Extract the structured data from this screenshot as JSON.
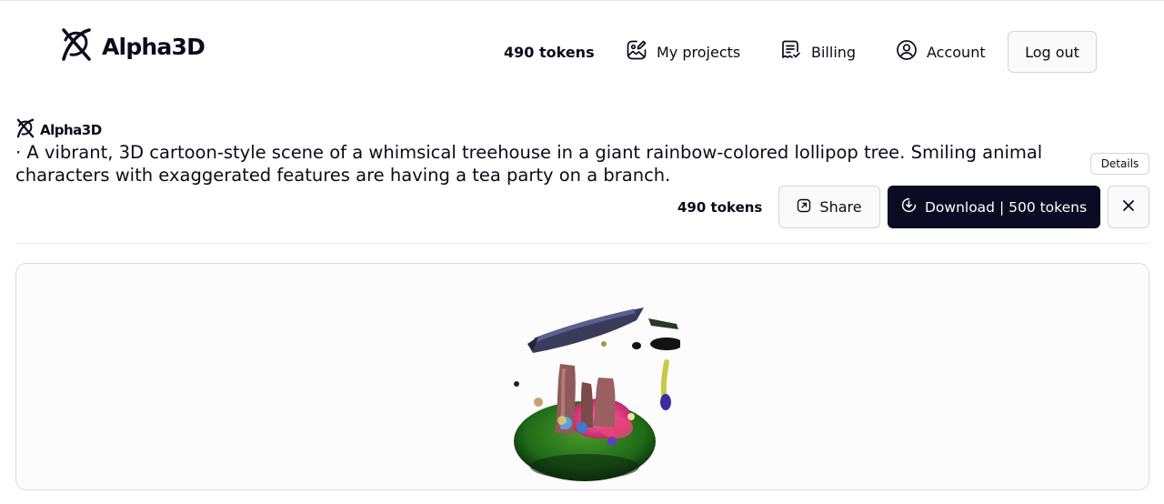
{
  "header": {
    "logo_text": "Alpha3D",
    "tokens": "490 tokens",
    "nav": {
      "projects": "My projects",
      "billing": "Billing",
      "account": "Account"
    },
    "logout_label": "Log out"
  },
  "project": {
    "brand": "Alpha3D",
    "description": "· A vibrant, 3D cartoon-style scene of a whimsical treehouse in a giant rainbow-colored lollipop tree. Smiling animal characters with exaggerated features are having a tea party on a branch.",
    "details_label": "Details",
    "tokens": "490 tokens",
    "share_label": "Share",
    "download_label": "Download | 500 tokens"
  },
  "icons": {
    "logo": "alpha3d-logo-icon",
    "projects": "image-edit-icon",
    "billing": "receipt-icon",
    "account": "user-circle-icon",
    "share": "external-link-icon",
    "download": "download-circle-icon",
    "close": "close-icon"
  },
  "colors": {
    "primary_dark": "#0b0b24",
    "border": "#d4d4d8",
    "text": "#0b0b1a"
  }
}
